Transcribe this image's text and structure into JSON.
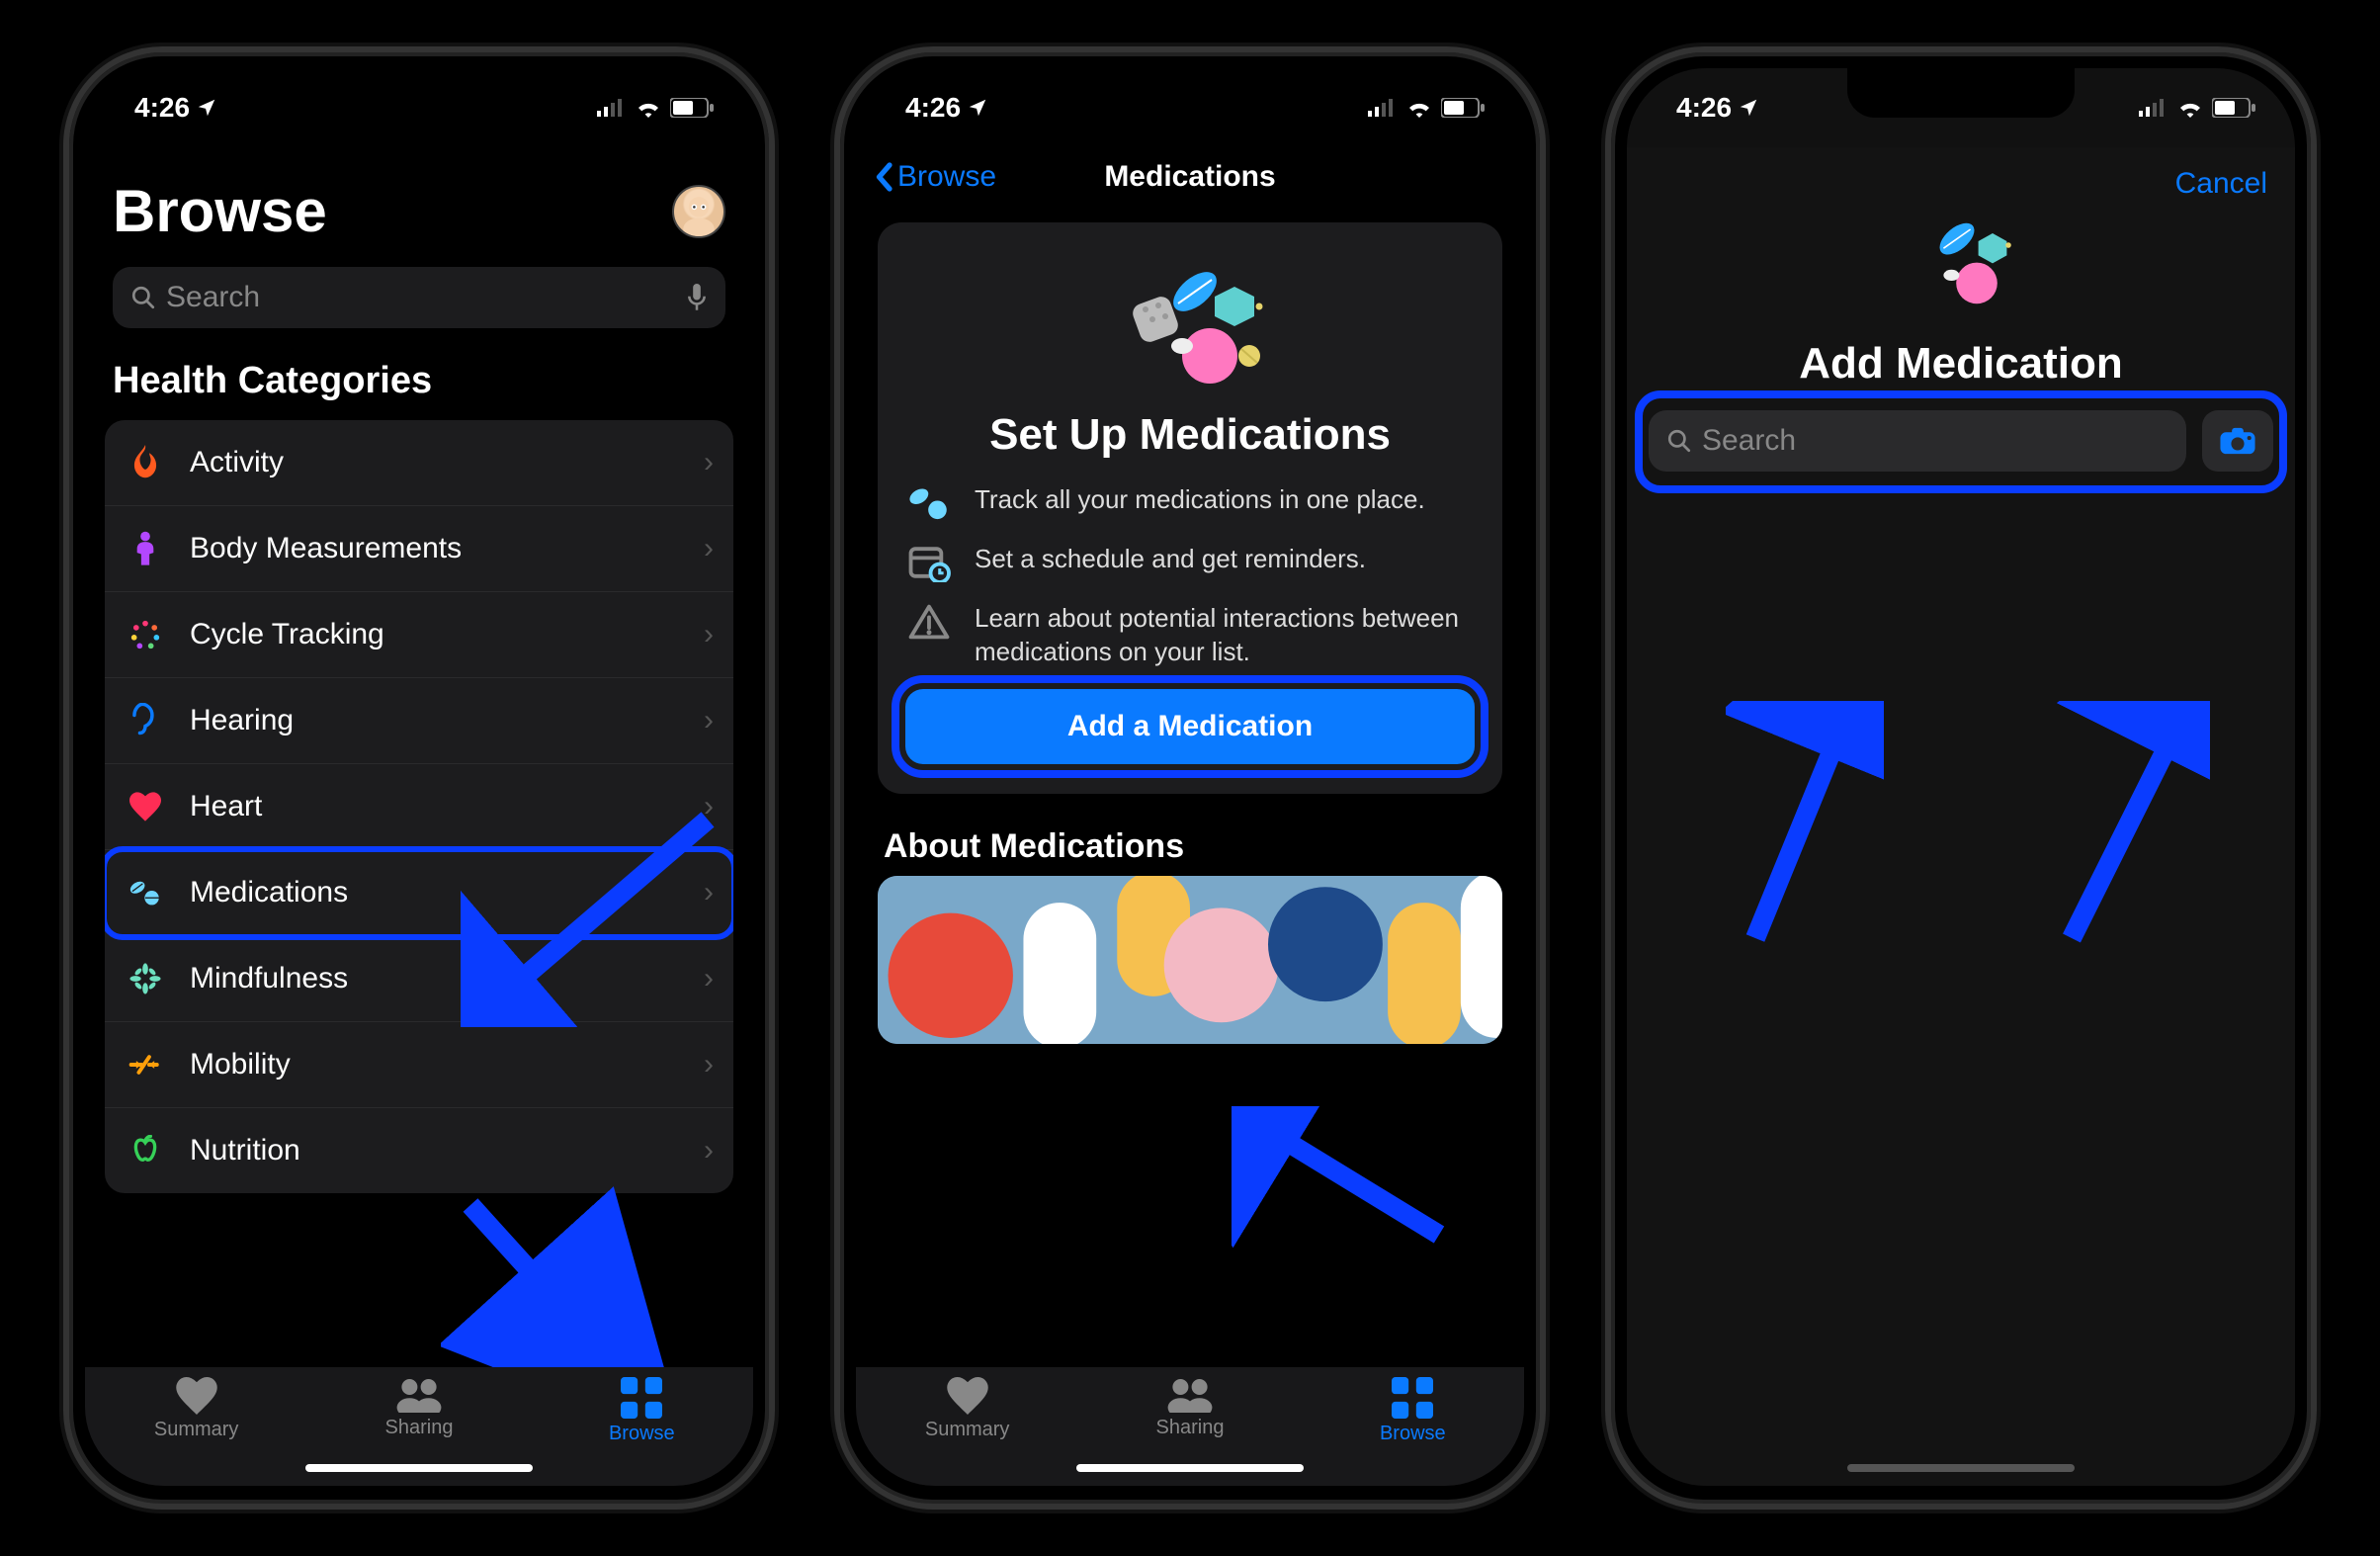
{
  "status": {
    "time": "4:26"
  },
  "screen1": {
    "title": "Browse",
    "search_placeholder": "Search",
    "section": "Health Categories",
    "rows": [
      {
        "label": "Activity"
      },
      {
        "label": "Body Measurements"
      },
      {
        "label": "Cycle Tracking"
      },
      {
        "label": "Hearing"
      },
      {
        "label": "Heart"
      },
      {
        "label": "Medications"
      },
      {
        "label": "Mindfulness"
      },
      {
        "label": "Mobility"
      },
      {
        "label": "Nutrition"
      }
    ],
    "tabs": {
      "summary": "Summary",
      "sharing": "Sharing",
      "browse": "Browse"
    }
  },
  "screen2": {
    "back": "Browse",
    "title": "Medications",
    "card_title": "Set Up Medications",
    "feat1": "Track all your medications in one place.",
    "feat2": "Set a schedule and get reminders.",
    "feat3": "Learn about potential interactions between medications on your list.",
    "cta": "Add a Medication",
    "about": "About Medications",
    "tabs": {
      "summary": "Summary",
      "sharing": "Sharing",
      "browse": "Browse"
    }
  },
  "screen3": {
    "cancel": "Cancel",
    "title": "Add Medication",
    "search_placeholder": "Search"
  }
}
